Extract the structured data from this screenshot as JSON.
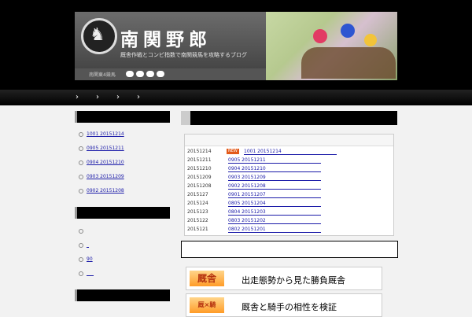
{
  "header": {
    "site_title": "南関野郎",
    "tagline": "厩舎作戦とコンビ指数で南関競馬を攻略するブログ",
    "linkbar_label": "南関東4競馬",
    "logo_glyph": "♞"
  },
  "nav": {
    "items": [
      "›",
      "›",
      "›",
      "›"
    ]
  },
  "sidebar": {
    "recent": [
      {
        "label": "1001 20151214"
      },
      {
        "label": "0905 20151211"
      },
      {
        "label": "0904 20151210"
      },
      {
        "label": "0903 20151209"
      },
      {
        "label": "0902 20151208"
      }
    ],
    "second": [
      {
        "label": ""
      },
      {
        "label": "_"
      },
      {
        "label": "90"
      },
      {
        "label": "___"
      }
    ]
  },
  "entries": [
    {
      "date": "20151214",
      "new": "NEW",
      "title": "1001 20151214"
    },
    {
      "date": "20151211",
      "title": "0905 20151211"
    },
    {
      "date": "20151210",
      "title": "0904 20151210"
    },
    {
      "date": "20151209",
      "title": "0903 20151209"
    },
    {
      "date": "20151208",
      "title": "0902 20151208"
    },
    {
      "date": "2015127",
      "title": "0901 20151207"
    },
    {
      "date": "2015124",
      "title": "0805 20151204"
    },
    {
      "date": "2015123",
      "title": "0804 20151203"
    },
    {
      "date": "2015122",
      "title": "0803 20151202"
    },
    {
      "date": "2015121",
      "title": "0802 20151201"
    }
  ],
  "banners": [
    {
      "icon": "厩舎",
      "text": "出走態勢から見た勝負厩舎"
    },
    {
      "icon": "厩×騎",
      "text": "厩舎と騎手の相性を検証"
    }
  ]
}
